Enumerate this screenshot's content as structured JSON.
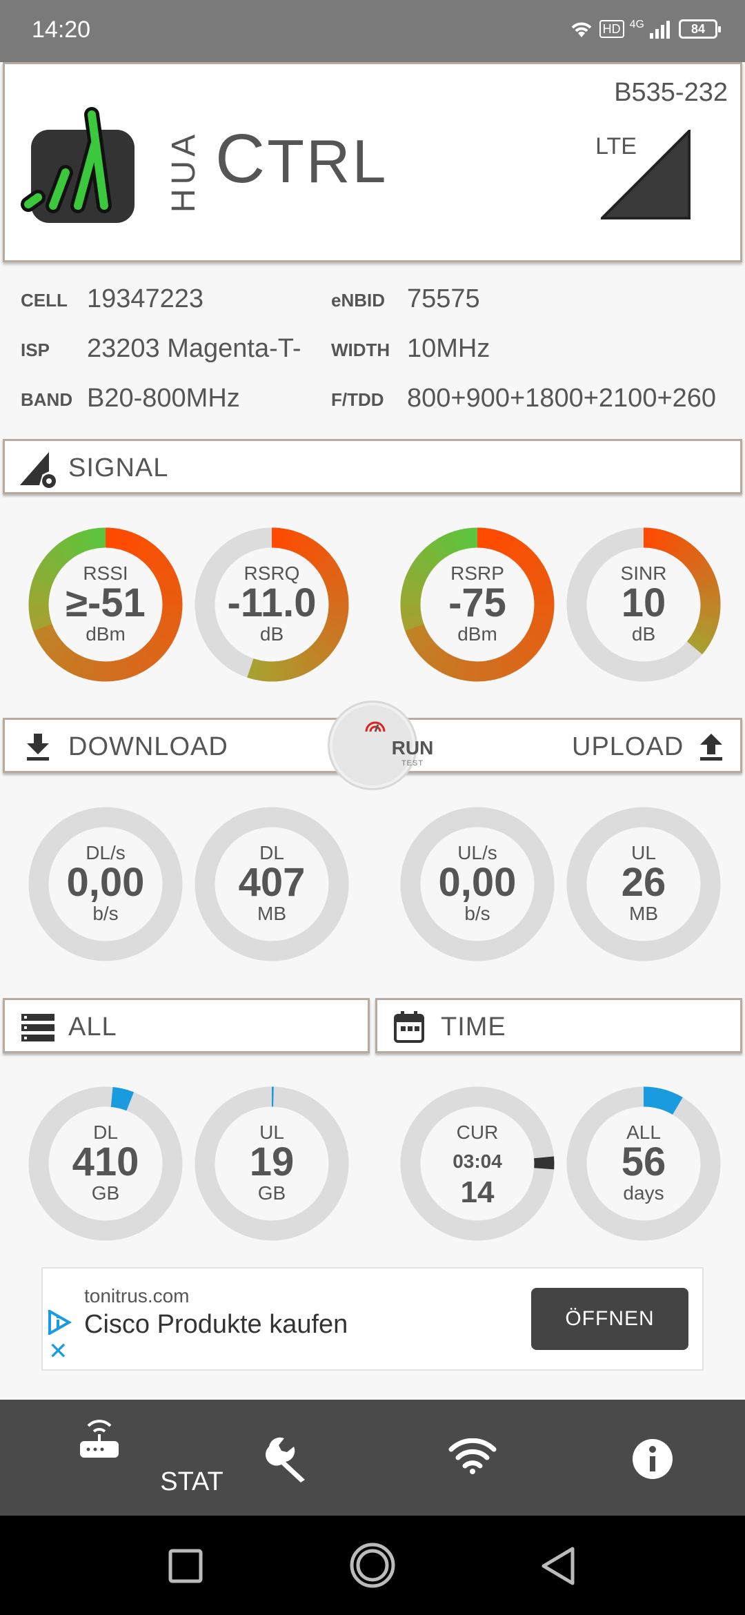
{
  "status_bar": {
    "time": "14:20",
    "net_badge": "HD",
    "net_type": "4G",
    "battery": "84"
  },
  "header": {
    "logo_left": "HUA",
    "logo_main_first": "C",
    "logo_main_rest": "TRL",
    "model": "B535-232",
    "network_mode": "LTE",
    "icon": "signal-bars-logo"
  },
  "info": {
    "cell_label": "CELL",
    "cell_value": "19347223",
    "enbid_label": "eNBID",
    "enbid_value": "75575",
    "isp_label": "ISP",
    "isp_value": "23203 Magenta-T-",
    "width_label": "WIDTH",
    "width_value": "10MHz",
    "band_label": "BAND",
    "band_value": "B20-800MHz",
    "ftdd_label": "F/TDD",
    "ftdd_value": "800+900+1800+2100+260"
  },
  "signal_section": {
    "label": "SIGNAL",
    "icon": "signal-settings-icon"
  },
  "signal_gauges": [
    {
      "label": "RSSI",
      "value": "≥-51",
      "unit": "dBm",
      "level": 1.0
    },
    {
      "label": "RSRQ",
      "value": "-11.0",
      "unit": "dB",
      "level": 0.55
    },
    {
      "label": "RSRP",
      "value": "-75",
      "unit": "dBm",
      "level": 1.0
    },
    {
      "label": "SINR",
      "value": "10",
      "unit": "dB",
      "level": 0.36
    }
  ],
  "transfer_section": {
    "download_label": "DOWNLOAD",
    "upload_label": "UPLOAD",
    "run_label": "RUN",
    "run_sub": "TEST"
  },
  "transfer_gauges": [
    {
      "label": "DL/s",
      "value": "0,00",
      "unit": "b/s"
    },
    {
      "label": "DL",
      "value": "407",
      "unit": "MB"
    },
    {
      "label": "UL/s",
      "value": "0,00",
      "unit": "b/s"
    },
    {
      "label": "UL",
      "value": "26",
      "unit": "MB"
    }
  ],
  "totals_section": {
    "all_label": "ALL",
    "time_label": "TIME"
  },
  "totals_gauges": [
    {
      "label": "DL",
      "value": "410",
      "unit": "GB"
    },
    {
      "label": "UL",
      "value": "19",
      "unit": "GB"
    },
    {
      "label": "CUR",
      "time": "03:04",
      "value": "14"
    },
    {
      "label": "ALL",
      "value": "56",
      "unit": "days"
    }
  ],
  "ad": {
    "domain": "tonitrus.com",
    "title": "Cisco Produkte kaufen",
    "button": "ÖFFNEN"
  },
  "bottom_nav": {
    "stat_label": "STAT"
  },
  "colors": {
    "accent_blue": "#1a9be0",
    "gauge_track": "#dcdcdc",
    "gradient_green": "#5cc43d",
    "gradient_red": "#ff4a00"
  }
}
